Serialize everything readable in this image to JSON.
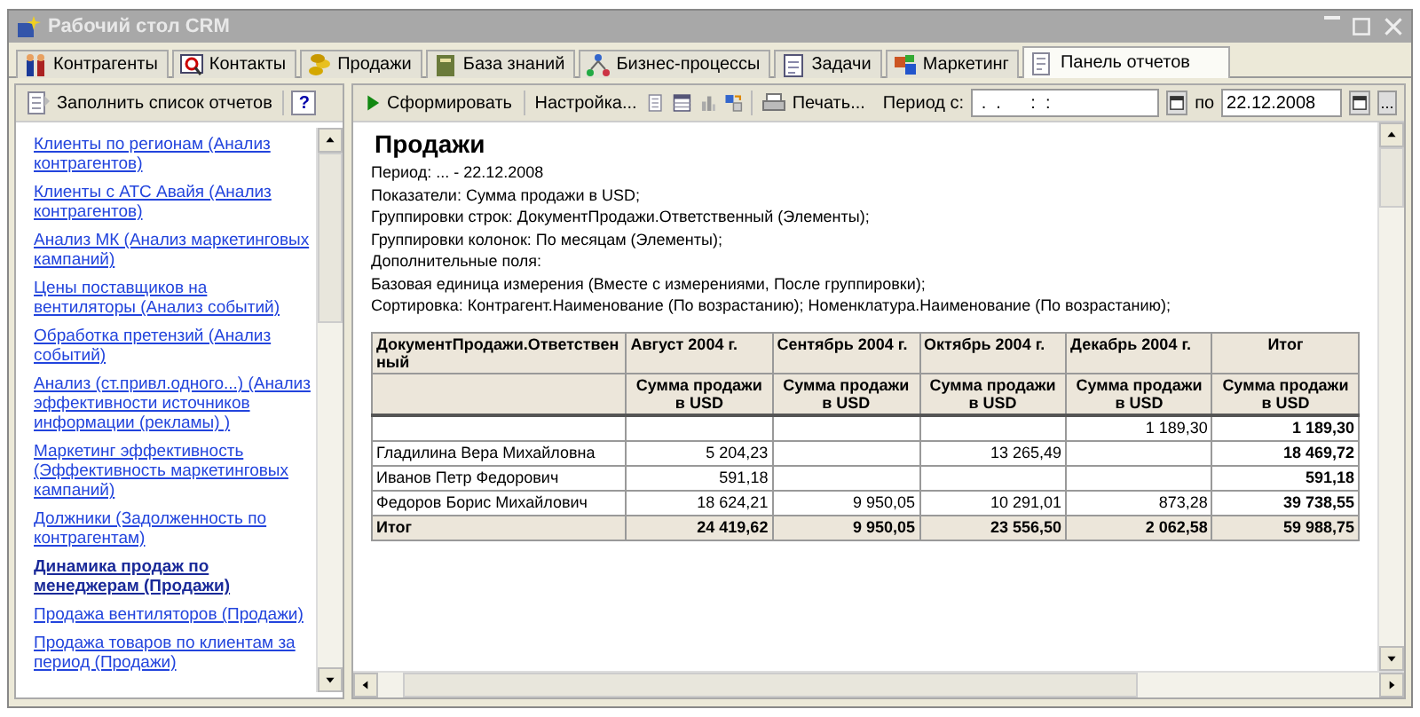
{
  "window": {
    "title": "Рабочий стол CRM"
  },
  "tabs": [
    {
      "label": "Контрагенты",
      "selected": false
    },
    {
      "label": "Контакты",
      "selected": false
    },
    {
      "label": "Продажи",
      "selected": false
    },
    {
      "label": "База знаний",
      "selected": false
    },
    {
      "label": "Бизнес-процессы",
      "selected": false
    },
    {
      "label": "Задачи",
      "selected": false
    },
    {
      "label": "Маркетинг",
      "selected": false
    },
    {
      "label": "Панель отчетов",
      "selected": true
    }
  ],
  "left_toolbar": {
    "fill_button": "Заполнить список отчетов",
    "help_button": "?"
  },
  "reports": [
    {
      "label": "Клиенты по регионам (Анализ контрагентов)",
      "selected": false
    },
    {
      "label": "Клиенты с АТС Авайя (Анализ контрагентов)",
      "selected": false
    },
    {
      "label": "Анализ МК (Анализ маркетинговых кампаний)",
      "selected": false
    },
    {
      "label": "Цены поставщиков на вентиляторы (Анализ событий)",
      "selected": false
    },
    {
      "label": "Обработка претензий (Анализ событий)",
      "selected": false
    },
    {
      "label": "Анализ (ст.привл.одного...) (Анализ эффективности источников информации (рекламы) )",
      "selected": false
    },
    {
      "label": "Маркетинг эффективность (Эффективность маркетинговых кампаний)",
      "selected": false
    },
    {
      "label": "Должники (Задолженность по контрагентам)",
      "selected": false
    },
    {
      "label": "Динамика продаж по менеджерам (Продажи)",
      "selected": true
    },
    {
      "label": "Продажа вентиляторов (Продажи)",
      "selected": false
    },
    {
      "label": "Продажа товаров по клиентам за период (Продажи)",
      "selected": false
    }
  ],
  "report_toolbar": {
    "generate_button": "Сформировать",
    "settings_button": "Настройка...",
    "print_button": "Печать...",
    "period_label": "Период с:",
    "period_from": " .  .      :  : ",
    "to_label": "по",
    "period_to": "22.12.2008",
    "more_button": "..."
  },
  "report": {
    "title": "Продажи",
    "lines": [
      "Период: ... - 22.12.2008",
      "Показатели: Сумма продажи в USD;",
      "Группировки строк: ДокументПродажи.Ответственный (Элементы);",
      "Группировки колонок: По месяцам (Элементы);",
      "Дополнительные поля:",
      "Базовая единица измерения (Вместе с измерениями, После группировки);",
      "Сортировка: Контрагент.Наименование (По возрастанию); Номенклатура.Наименование (По возрастанию);"
    ],
    "table": {
      "header_row_1": [
        "ДокументПродажи.Ответственный",
        "Август 2004 г.",
        "Сентябрь 2004 г.",
        "Октябрь 2004 г.",
        "Декабрь 2004 г.",
        "Итог"
      ],
      "header_row_2": [
        "Сумма продажи в USD",
        "Сумма продажи в USD",
        "Сумма продажи в USD",
        "Сумма продажи в USD",
        "Сумма продажи в USD"
      ],
      "rows": [
        [
          null,
          null,
          null,
          null,
          "1 189,30",
          "1 189,30"
        ],
        [
          "Гладилина Вера Михайловна",
          "5 204,23",
          null,
          "13 265,49",
          null,
          "18 469,72"
        ],
        [
          "Иванов Петр Федорович",
          "591,18",
          null,
          null,
          null,
          "591,18"
        ],
        [
          "Федоров Борис Михайлович",
          "18 624,21",
          "9 950,05",
          "10 291,01",
          "873,28",
          "39 738,55"
        ]
      ],
      "total_row": [
        "Итог",
        "24 419,62",
        "9 950,05",
        "23 556,50",
        "2 062,58",
        "59 988,75"
      ]
    }
  }
}
